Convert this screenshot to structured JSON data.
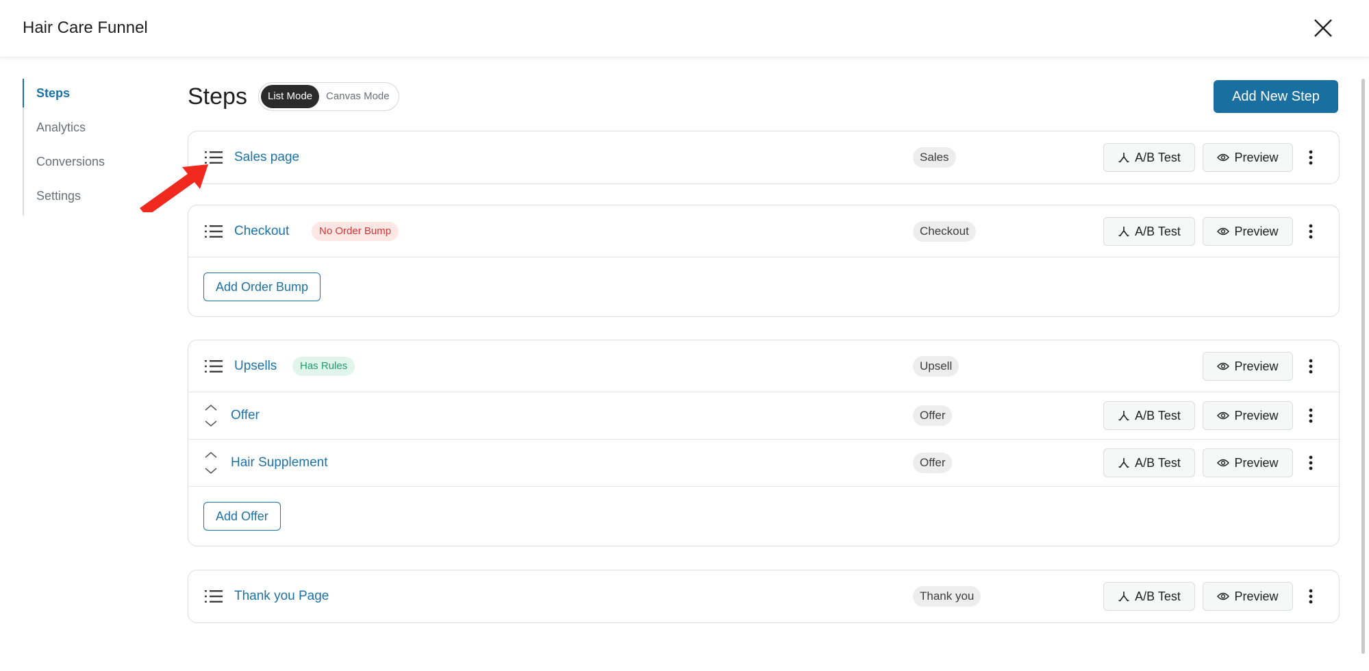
{
  "window": {
    "title": "Hair Care Funnel",
    "close_icon": "close-icon"
  },
  "sidebar": {
    "items": [
      {
        "label": "Steps",
        "active": true
      },
      {
        "label": "Analytics",
        "active": false
      },
      {
        "label": "Conversions",
        "active": false
      },
      {
        "label": "Settings",
        "active": false
      }
    ]
  },
  "main": {
    "heading": "Steps",
    "modes": {
      "list": "List Mode",
      "canvas": "Canvas Mode",
      "selected": "List Mode"
    },
    "add_step_label": "Add New Step"
  },
  "labels": {
    "ab_test": "A/B Test",
    "preview": "Preview"
  },
  "steps": {
    "sales": {
      "name": "Sales page",
      "type": "Sales"
    },
    "checkout": {
      "name": "Checkout",
      "tag": "No Order Bump",
      "type": "Checkout",
      "action": "Add Order Bump"
    },
    "upsells": {
      "name": "Upsells",
      "tag": "Has Rules",
      "type": "Upsell",
      "offers": [
        {
          "name": "Offer",
          "type": "Offer"
        },
        {
          "name": "Hair Supplement",
          "type": "Offer"
        }
      ],
      "action": "Add Offer"
    },
    "thankyou": {
      "name": "Thank you Page",
      "type": "Thank you"
    }
  },
  "colors": {
    "accent": "#1c72a6",
    "primary_button": "#1a6fa1",
    "annotation_arrow": "#f0291e"
  }
}
